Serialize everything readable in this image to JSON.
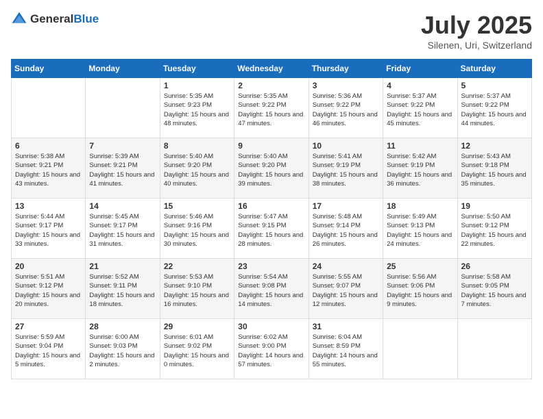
{
  "header": {
    "logo_general": "General",
    "logo_blue": "Blue",
    "month_title": "July 2025",
    "location": "Silenen, Uri, Switzerland"
  },
  "weekdays": [
    "Sunday",
    "Monday",
    "Tuesday",
    "Wednesday",
    "Thursday",
    "Friday",
    "Saturday"
  ],
  "weeks": [
    [
      {
        "day": "",
        "sunrise": "",
        "sunset": "",
        "daylight": ""
      },
      {
        "day": "",
        "sunrise": "",
        "sunset": "",
        "daylight": ""
      },
      {
        "day": "1",
        "sunrise": "Sunrise: 5:35 AM",
        "sunset": "Sunset: 9:23 PM",
        "daylight": "Daylight: 15 hours and 48 minutes."
      },
      {
        "day": "2",
        "sunrise": "Sunrise: 5:35 AM",
        "sunset": "Sunset: 9:22 PM",
        "daylight": "Daylight: 15 hours and 47 minutes."
      },
      {
        "day": "3",
        "sunrise": "Sunrise: 5:36 AM",
        "sunset": "Sunset: 9:22 PM",
        "daylight": "Daylight: 15 hours and 46 minutes."
      },
      {
        "day": "4",
        "sunrise": "Sunrise: 5:37 AM",
        "sunset": "Sunset: 9:22 PM",
        "daylight": "Daylight: 15 hours and 45 minutes."
      },
      {
        "day": "5",
        "sunrise": "Sunrise: 5:37 AM",
        "sunset": "Sunset: 9:22 PM",
        "daylight": "Daylight: 15 hours and 44 minutes."
      }
    ],
    [
      {
        "day": "6",
        "sunrise": "Sunrise: 5:38 AM",
        "sunset": "Sunset: 9:21 PM",
        "daylight": "Daylight: 15 hours and 43 minutes."
      },
      {
        "day": "7",
        "sunrise": "Sunrise: 5:39 AM",
        "sunset": "Sunset: 9:21 PM",
        "daylight": "Daylight: 15 hours and 41 minutes."
      },
      {
        "day": "8",
        "sunrise": "Sunrise: 5:40 AM",
        "sunset": "Sunset: 9:20 PM",
        "daylight": "Daylight: 15 hours and 40 minutes."
      },
      {
        "day": "9",
        "sunrise": "Sunrise: 5:40 AM",
        "sunset": "Sunset: 9:20 PM",
        "daylight": "Daylight: 15 hours and 39 minutes."
      },
      {
        "day": "10",
        "sunrise": "Sunrise: 5:41 AM",
        "sunset": "Sunset: 9:19 PM",
        "daylight": "Daylight: 15 hours and 38 minutes."
      },
      {
        "day": "11",
        "sunrise": "Sunrise: 5:42 AM",
        "sunset": "Sunset: 9:19 PM",
        "daylight": "Daylight: 15 hours and 36 minutes."
      },
      {
        "day": "12",
        "sunrise": "Sunrise: 5:43 AM",
        "sunset": "Sunset: 9:18 PM",
        "daylight": "Daylight: 15 hours and 35 minutes."
      }
    ],
    [
      {
        "day": "13",
        "sunrise": "Sunrise: 5:44 AM",
        "sunset": "Sunset: 9:17 PM",
        "daylight": "Daylight: 15 hours and 33 minutes."
      },
      {
        "day": "14",
        "sunrise": "Sunrise: 5:45 AM",
        "sunset": "Sunset: 9:17 PM",
        "daylight": "Daylight: 15 hours and 31 minutes."
      },
      {
        "day": "15",
        "sunrise": "Sunrise: 5:46 AM",
        "sunset": "Sunset: 9:16 PM",
        "daylight": "Daylight: 15 hours and 30 minutes."
      },
      {
        "day": "16",
        "sunrise": "Sunrise: 5:47 AM",
        "sunset": "Sunset: 9:15 PM",
        "daylight": "Daylight: 15 hours and 28 minutes."
      },
      {
        "day": "17",
        "sunrise": "Sunrise: 5:48 AM",
        "sunset": "Sunset: 9:14 PM",
        "daylight": "Daylight: 15 hours and 26 minutes."
      },
      {
        "day": "18",
        "sunrise": "Sunrise: 5:49 AM",
        "sunset": "Sunset: 9:13 PM",
        "daylight": "Daylight: 15 hours and 24 minutes."
      },
      {
        "day": "19",
        "sunrise": "Sunrise: 5:50 AM",
        "sunset": "Sunset: 9:12 PM",
        "daylight": "Daylight: 15 hours and 22 minutes."
      }
    ],
    [
      {
        "day": "20",
        "sunrise": "Sunrise: 5:51 AM",
        "sunset": "Sunset: 9:12 PM",
        "daylight": "Daylight: 15 hours and 20 minutes."
      },
      {
        "day": "21",
        "sunrise": "Sunrise: 5:52 AM",
        "sunset": "Sunset: 9:11 PM",
        "daylight": "Daylight: 15 hours and 18 minutes."
      },
      {
        "day": "22",
        "sunrise": "Sunrise: 5:53 AM",
        "sunset": "Sunset: 9:10 PM",
        "daylight": "Daylight: 15 hours and 16 minutes."
      },
      {
        "day": "23",
        "sunrise": "Sunrise: 5:54 AM",
        "sunset": "Sunset: 9:08 PM",
        "daylight": "Daylight: 15 hours and 14 minutes."
      },
      {
        "day": "24",
        "sunrise": "Sunrise: 5:55 AM",
        "sunset": "Sunset: 9:07 PM",
        "daylight": "Daylight: 15 hours and 12 minutes."
      },
      {
        "day": "25",
        "sunrise": "Sunrise: 5:56 AM",
        "sunset": "Sunset: 9:06 PM",
        "daylight": "Daylight: 15 hours and 9 minutes."
      },
      {
        "day": "26",
        "sunrise": "Sunrise: 5:58 AM",
        "sunset": "Sunset: 9:05 PM",
        "daylight": "Daylight: 15 hours and 7 minutes."
      }
    ],
    [
      {
        "day": "27",
        "sunrise": "Sunrise: 5:59 AM",
        "sunset": "Sunset: 9:04 PM",
        "daylight": "Daylight: 15 hours and 5 minutes."
      },
      {
        "day": "28",
        "sunrise": "Sunrise: 6:00 AM",
        "sunset": "Sunset: 9:03 PM",
        "daylight": "Daylight: 15 hours and 2 minutes."
      },
      {
        "day": "29",
        "sunrise": "Sunrise: 6:01 AM",
        "sunset": "Sunset: 9:02 PM",
        "daylight": "Daylight: 15 hours and 0 minutes."
      },
      {
        "day": "30",
        "sunrise": "Sunrise: 6:02 AM",
        "sunset": "Sunset: 9:00 PM",
        "daylight": "Daylight: 14 hours and 57 minutes."
      },
      {
        "day": "31",
        "sunrise": "Sunrise: 6:04 AM",
        "sunset": "Sunset: 8:59 PM",
        "daylight": "Daylight: 14 hours and 55 minutes."
      },
      {
        "day": "",
        "sunrise": "",
        "sunset": "",
        "daylight": ""
      },
      {
        "day": "",
        "sunrise": "",
        "sunset": "",
        "daylight": ""
      }
    ]
  ]
}
